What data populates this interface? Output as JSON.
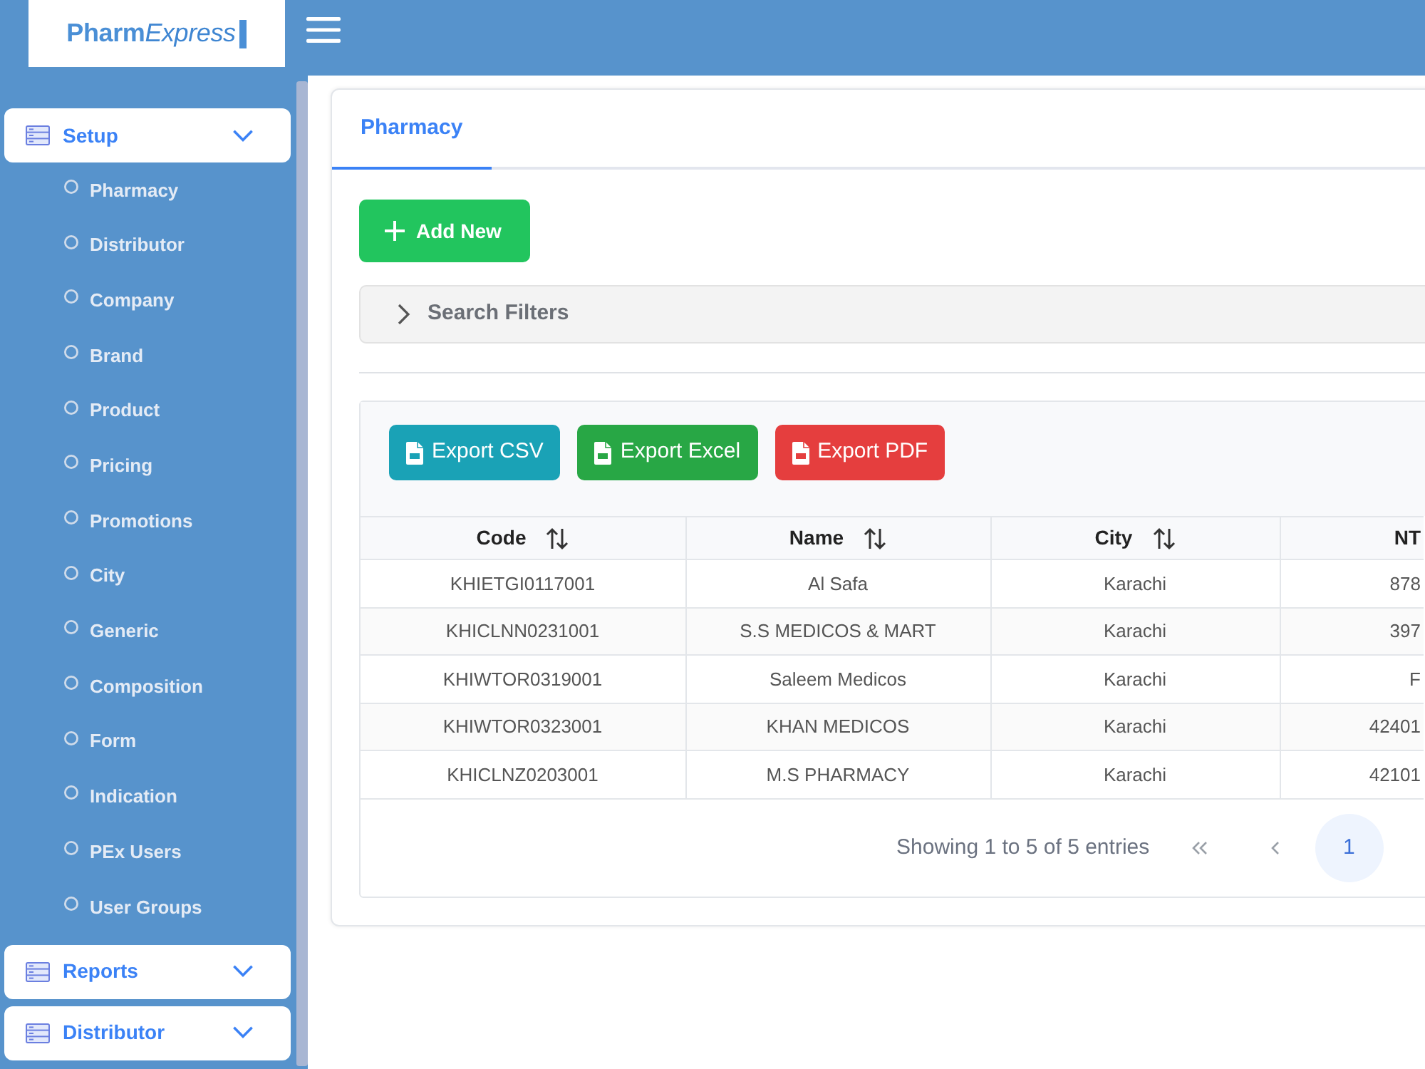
{
  "header": {
    "logo": {
      "part_1": "Pharm",
      "part_2": "Express"
    }
  },
  "sidebar": {
    "groups": [
      {
        "label": "Setup",
        "children": [
          {
            "label": "Pharmacy"
          },
          {
            "label": "Distributor"
          },
          {
            "label": "Company"
          },
          {
            "label": "Brand"
          },
          {
            "label": "Product"
          },
          {
            "label": "Pricing"
          },
          {
            "label": "Promotions"
          },
          {
            "label": "City"
          },
          {
            "label": "Generic"
          },
          {
            "label": "Composition"
          },
          {
            "label": "Form"
          },
          {
            "label": "Indication"
          },
          {
            "label": "PEx Users"
          },
          {
            "label": "User Groups"
          }
        ]
      },
      {
        "label": "Reports"
      },
      {
        "label": "Distributor"
      }
    ]
  },
  "tabs": [
    {
      "label": "Pharmacy",
      "selected": true
    }
  ],
  "add_button": {
    "label": "Add New"
  },
  "search_filters": {
    "label": "Search Filters",
    "expanded": false
  },
  "export_buttons": [
    {
      "label": "Export CSV",
      "kind": "csv"
    },
    {
      "label": "Export Excel",
      "kind": "excel"
    },
    {
      "label": "Export PDF",
      "kind": "pdf"
    }
  ],
  "table": {
    "columns": [
      {
        "label": "Code",
        "sortable": true
      },
      {
        "label": "Name",
        "sortable": true
      },
      {
        "label": "City",
        "sortable": true
      },
      {
        "label": "NT",
        "sortable": false
      }
    ],
    "rows": [
      [
        "KHIETGI0117001",
        "Al Safa",
        "Karachi",
        "878"
      ],
      [
        "KHICLNN0231001",
        "S.S MEDICOS & MART",
        "Karachi",
        "397"
      ],
      [
        "KHIWTOR0319001",
        "Saleem Medicos",
        "Karachi",
        "F"
      ],
      [
        "KHIWTOR0323001",
        "KHAN MEDICOS",
        "Karachi",
        "42401"
      ],
      [
        "KHICLNZ0203001",
        "M.S PHARMACY",
        "Karachi",
        "42101"
      ]
    ]
  },
  "pagination": {
    "info": "Showing 1 to 5 of 5 entries",
    "pages": [
      {
        "label": "1",
        "selected": true
      }
    ]
  }
}
